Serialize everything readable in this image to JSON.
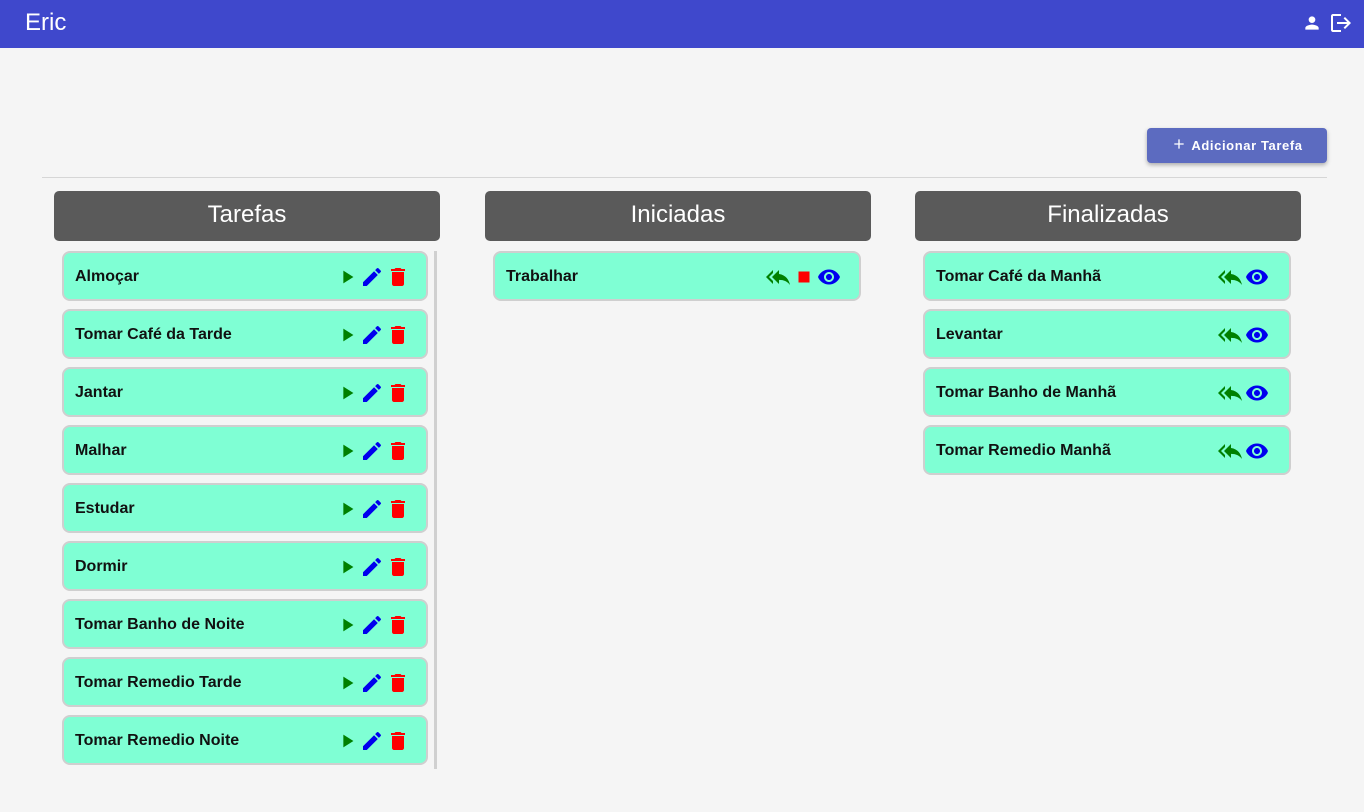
{
  "app": {
    "user_name": "Eric",
    "icons": [
      "user-icon",
      "logout-icon"
    ]
  },
  "toolbar": {
    "add_label": "Adicionar Tarefa"
  },
  "columns": {
    "todo": {
      "title": "Tarefas",
      "items": [
        "Almoçar",
        "Tomar Café da Tarde",
        "Jantar",
        "Malhar",
        "Estudar",
        "Dormir",
        "Tomar Banho de Noite",
        "Tomar Remedio Tarde",
        "Tomar Remedio Noite"
      ],
      "actions": [
        "play-icon",
        "edit-icon",
        "delete-icon"
      ]
    },
    "started": {
      "title": "Iniciadas",
      "items": [
        "Trabalhar"
      ],
      "actions": [
        "reply-all-icon",
        "stop-icon",
        "eye-icon"
      ]
    },
    "done": {
      "title": "Finalizadas",
      "items": [
        "Tomar Café da Manhã",
        "Levantar",
        "Tomar Banho de Manhã",
        "Tomar Remedio Manhã"
      ],
      "actions": [
        "reply-all-icon",
        "eye-icon"
      ]
    }
  },
  "colors": {
    "topbar": "#3f48cc",
    "button": "#5c6bc0",
    "column_header": "#5a5a5a",
    "card": "#7fffd4",
    "play": "#008000",
    "edit": "#0000ee",
    "delete": "#ff0000",
    "eye": "#0000ee",
    "reply": "#008000",
    "stop": "#ff0000"
  }
}
